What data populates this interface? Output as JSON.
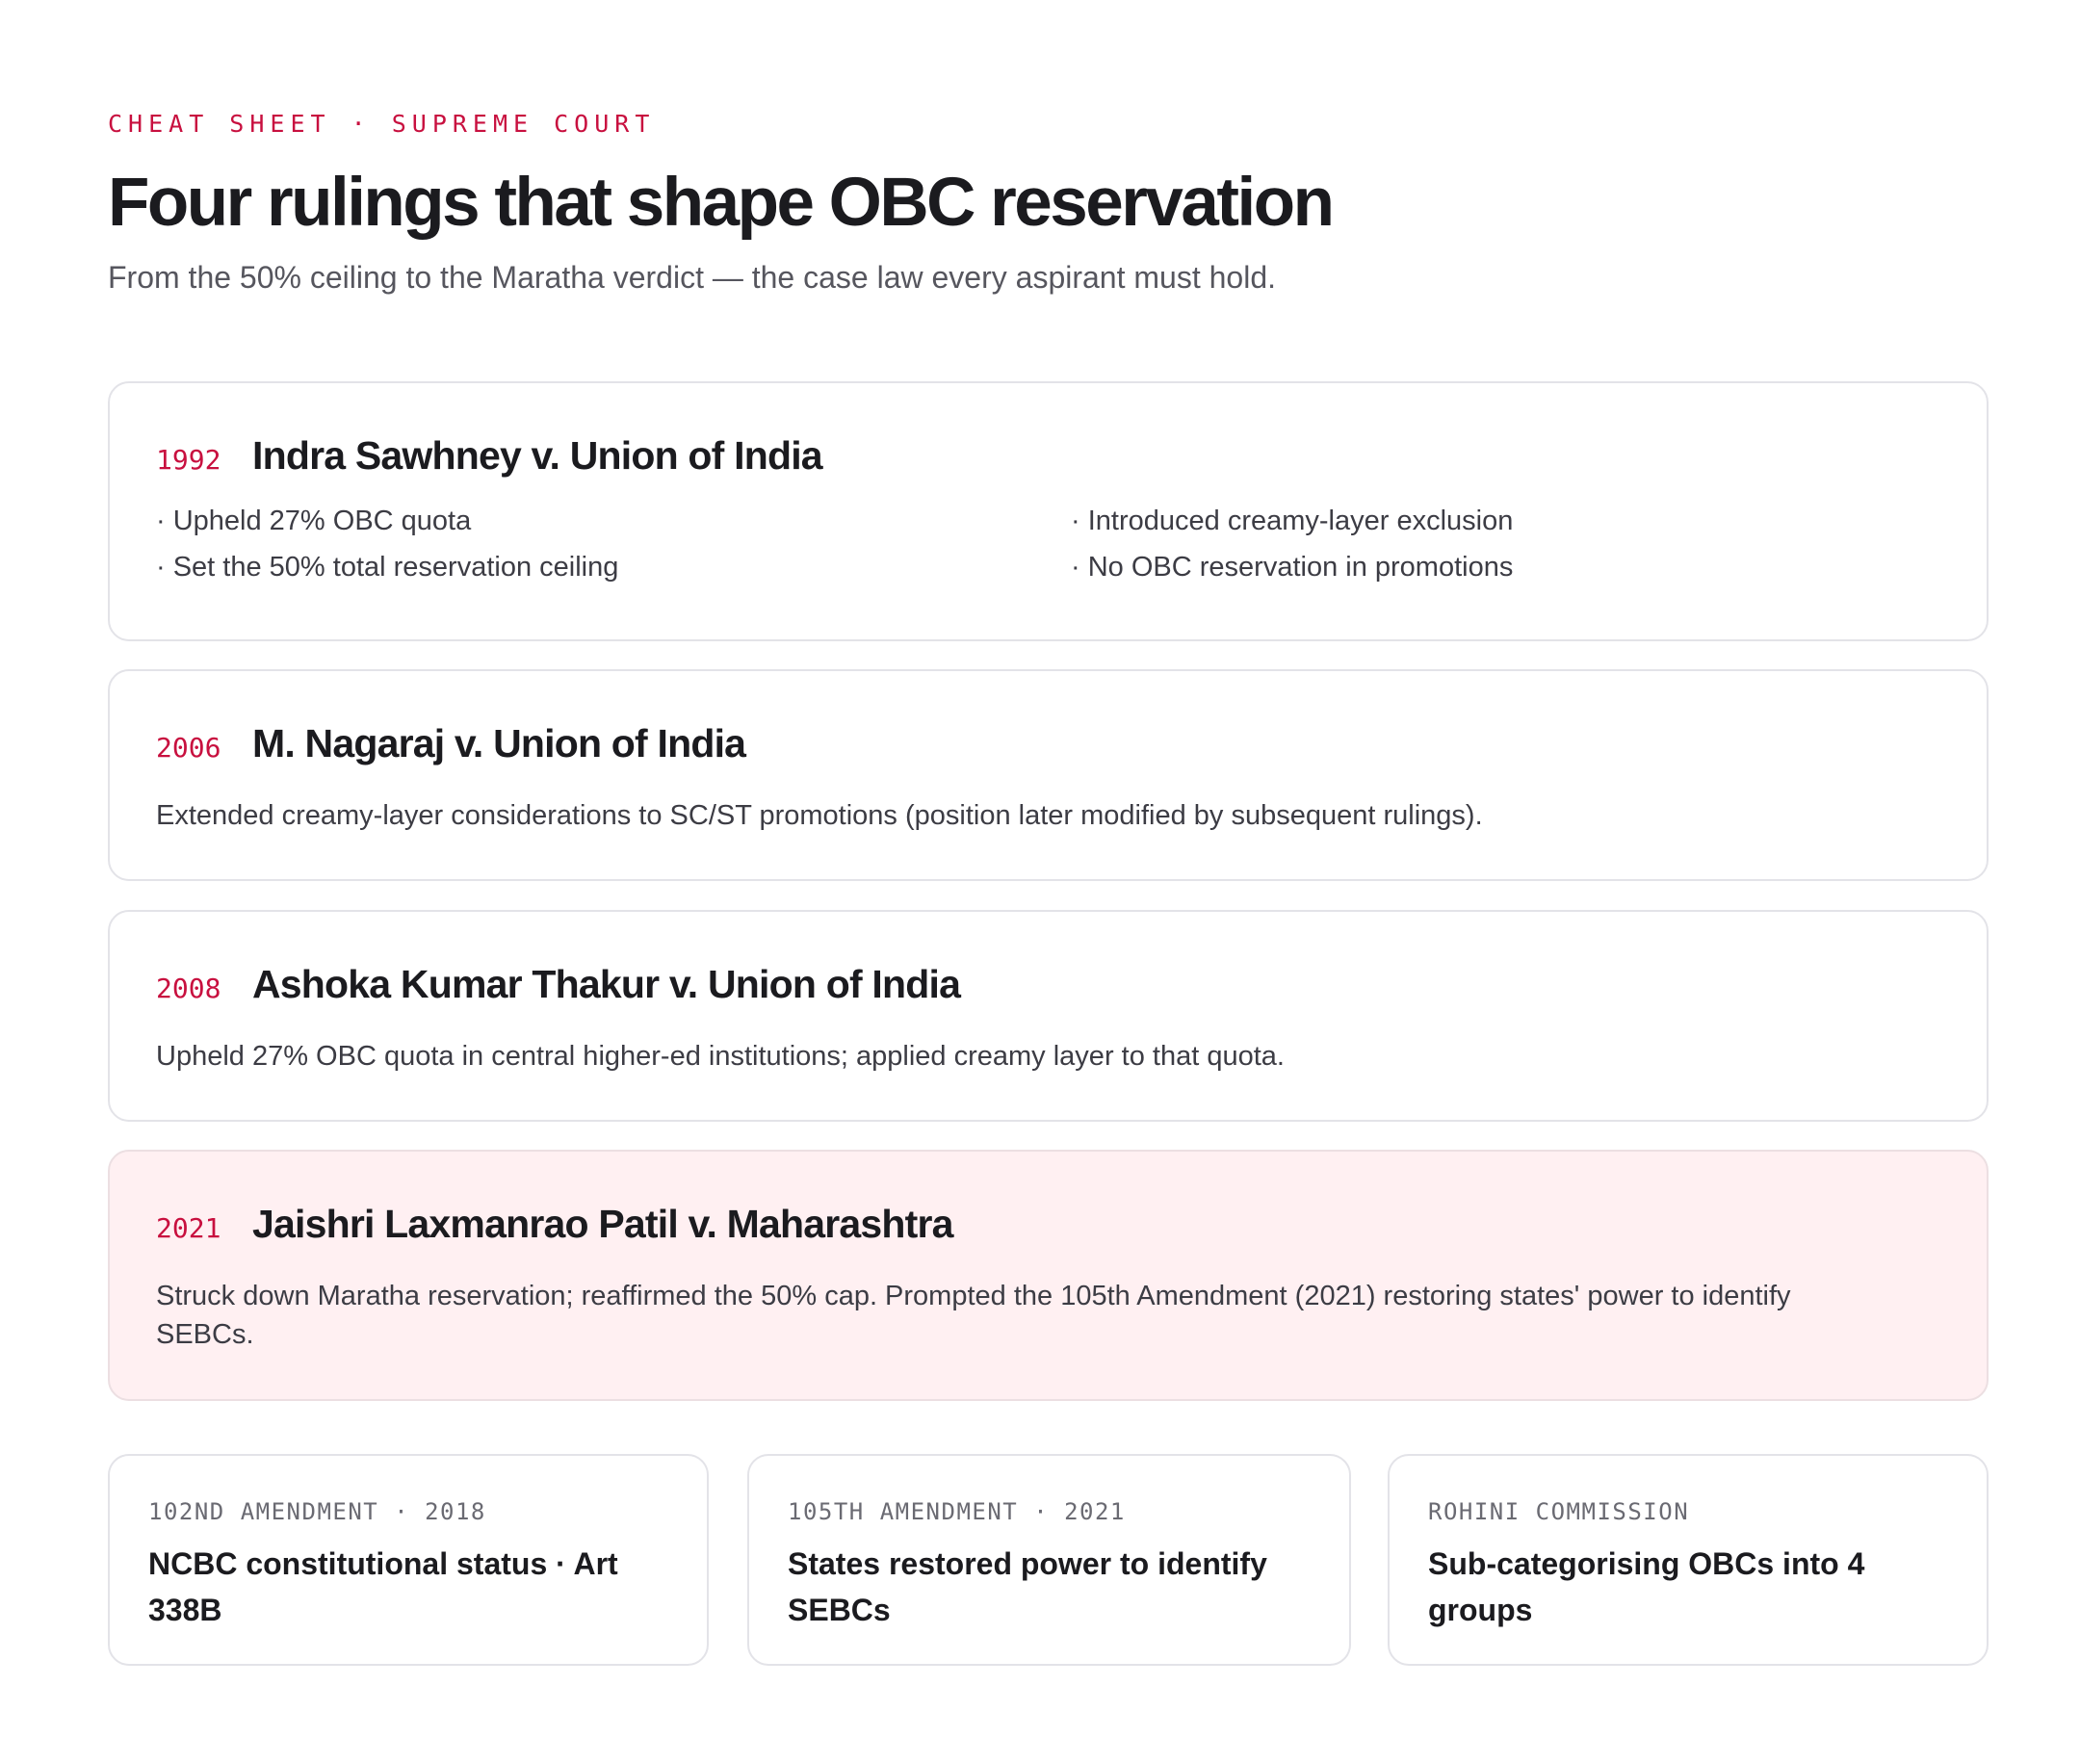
{
  "header": {
    "eyebrow": "CHEAT SHEET · SUPREME COURT",
    "title": "Four rulings that shape OBC reservation",
    "subtitle": "From the 50% ceiling to the Maratha verdict — the case law every aspirant must hold."
  },
  "rulings": [
    {
      "year": "1992",
      "name": "Indra Sawhney v. Union of India",
      "points": [
        "· Upheld 27% OBC quota",
        "· Introduced creamy-layer exclusion",
        "· Set the 50% total reservation ceiling",
        "· No OBC reservation in promotions"
      ]
    },
    {
      "year": "2006",
      "name": "M. Nagaraj v. Union of India",
      "description": "Extended creamy-layer considerations to SC/ST promotions (position later modified by subsequent rulings)."
    },
    {
      "year": "2008",
      "name": "Ashoka Kumar Thakur v. Union of India",
      "description": "Upheld 27% OBC quota in central higher-ed institutions; applied creamy layer to that quota."
    },
    {
      "year": "2021",
      "name": "Jaishri Laxmanrao Patil v. Maharashtra",
      "description": "Struck down Maratha reservation; reaffirmed the 50% cap. Prompted the 105th Amendment (2021) restoring states' power to identify SEBCs.",
      "highlighted": true
    }
  ],
  "facts": [
    {
      "label": "102ND AMENDMENT · 2018",
      "text": "NCBC constitutional status · Art 338B"
    },
    {
      "label": "105TH AMENDMENT · 2021",
      "text": "States restored power to identify SEBCs"
    },
    {
      "label": "ROHINI COMMISSION",
      "text": "Sub-categorising OBCs into 4 groups"
    }
  ],
  "colors": {
    "accent": "#c8103f",
    "highlight_background": "#fff0f2",
    "border": "#e3e3e8"
  }
}
